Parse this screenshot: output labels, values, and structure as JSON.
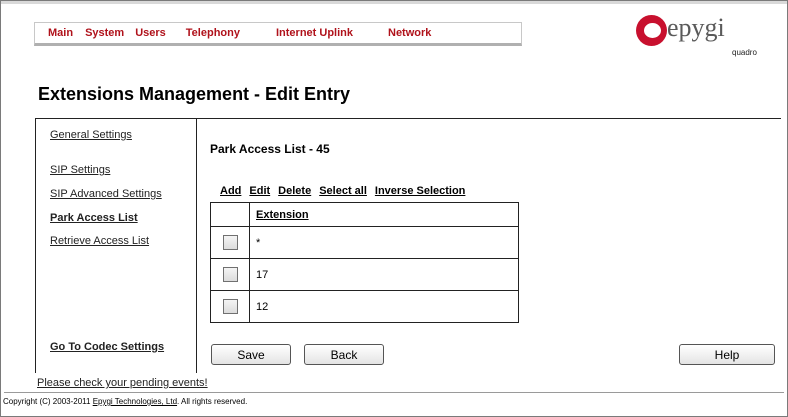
{
  "menu": {
    "items": [
      {
        "label": "Main"
      },
      {
        "label": "System"
      },
      {
        "label": "Users"
      },
      {
        "label": "Telephony"
      },
      {
        "label": "Internet Uplink"
      },
      {
        "label": "Network"
      }
    ]
  },
  "logo": {
    "text": "epygi",
    "sub": "quadro",
    "color": "#c8102e"
  },
  "page": {
    "title": "Extensions Management - Edit Entry"
  },
  "sidebar": {
    "items": [
      {
        "label": "General Settings"
      },
      {
        "label": "SIP Settings"
      },
      {
        "label": "SIP Advanced Settings"
      },
      {
        "label": "Park Access List"
      },
      {
        "label": "Retrieve Access List"
      }
    ],
    "bottom_link": "Go To Codec Settings"
  },
  "main": {
    "title": "Park Access List - 45",
    "actions": {
      "add": "Add",
      "edit": "Edit",
      "delete": "Delete",
      "select_all": "Select all",
      "inverse": "Inverse Selection"
    },
    "table": {
      "header": "Extension",
      "rows": [
        {
          "extension": "*"
        },
        {
          "extension": "17"
        },
        {
          "extension": "12"
        }
      ]
    },
    "buttons": {
      "save": "Save",
      "back": "Back",
      "help": "Help"
    }
  },
  "footer": {
    "pending": "Please check your pending events!",
    "copyright_pre": "Copyright (C) 2003-2011 ",
    "copyright_link": "Epygi Technologies, Ltd",
    "copyright_post": ". All rights reserved."
  }
}
